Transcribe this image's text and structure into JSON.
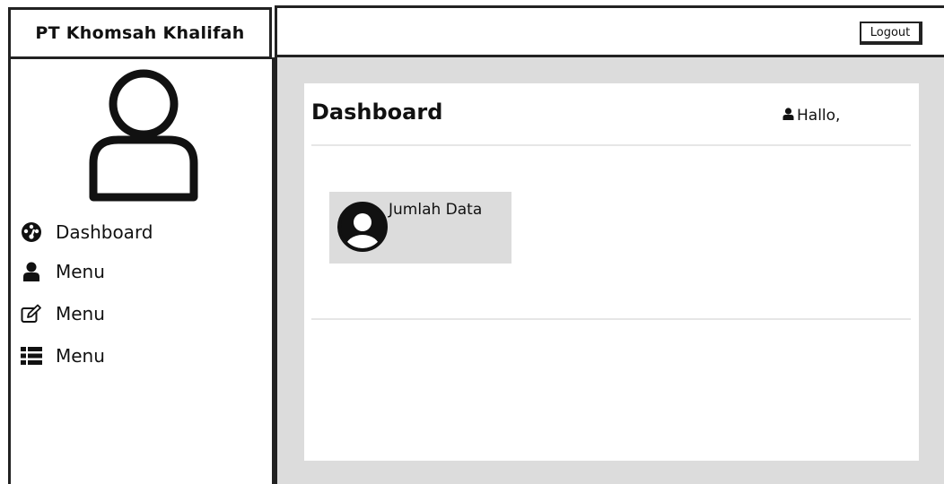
{
  "sidebar": {
    "company_name": "PT Khomsah Khalifah",
    "avatar_icon": "user-icon",
    "items": [
      {
        "label": "Dashboard",
        "icon": "dashboard-gauge-icon"
      },
      {
        "label": "Menu",
        "icon": "user-icon"
      },
      {
        "label": "Menu",
        "icon": "edit-icon"
      },
      {
        "label": "Menu",
        "icon": "list-icon"
      }
    ]
  },
  "topbar": {
    "logout_label": "Logout"
  },
  "main": {
    "title": "Dashboard",
    "greeting": "Hallo,",
    "greeting_icon": "user-icon",
    "stat_card": {
      "label": "Jumlah Data",
      "icon": "user-circle-icon"
    }
  },
  "colors": {
    "border": "#222222",
    "main_background": "#dcdcdc",
    "panel_background": "#ffffff",
    "card_background": "#dcdcdc"
  }
}
